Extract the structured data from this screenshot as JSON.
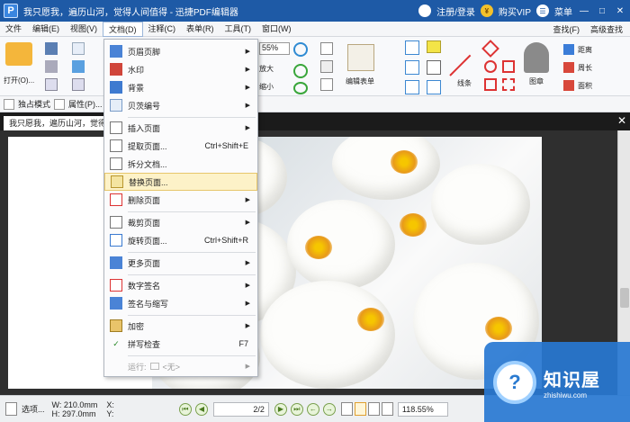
{
  "titlebar": {
    "logo_letter": "P",
    "title": "我只愿我，遍历山河，觉得人间值得 - 迅捷PDF编辑器",
    "login": "注册/登录",
    "vip_icon": "¥",
    "vip": "购买VIP",
    "menu_icon": "☰",
    "menu": "菜单",
    "minimize": "—",
    "maximize": "□",
    "close": "✕"
  },
  "menubar": {
    "items": [
      "文件",
      "编辑(E)",
      "视图(V)",
      "文档(D)",
      "注释(C)",
      "表单(R)",
      "工具(T)",
      "窗口(W)"
    ],
    "find": "查找(F)",
    "advanced_find": "高级查找"
  },
  "ribbon": {
    "open": "打开(O)...",
    "zoom_value": "55%",
    "zoom_in": "放大",
    "zoom_out": "缩小",
    "edit_form": "编辑表单",
    "line": "线条",
    "stamp": "图章",
    "distance": "距离",
    "perimeter": "周长",
    "area": "面积"
  },
  "quickbar": {
    "single_mode": "独占模式",
    "properties": "属性(P)..."
  },
  "tab": {
    "label": "我只愿我，遍历山河，觉得人",
    "close": "✕"
  },
  "dropdown": {
    "items": [
      {
        "label": "页眉页脚",
        "shortcut": "",
        "submenu": true,
        "icon": "header-footer-icon"
      },
      {
        "label": "水印",
        "shortcut": "",
        "submenu": true,
        "icon": "watermark-icon"
      },
      {
        "label": "背景",
        "shortcut": "",
        "submenu": true,
        "icon": "background-icon"
      },
      {
        "label": "贝茨编号",
        "shortcut": "",
        "submenu": true,
        "icon": "bates-icon"
      },
      {
        "label": "插入页面",
        "shortcut": "",
        "submenu": true,
        "icon": "insert-page-icon"
      },
      {
        "label": "提取页面...",
        "shortcut": "Ctrl+Shift+E",
        "submenu": false,
        "icon": "extract-page-icon"
      },
      {
        "label": "拆分文档...",
        "shortcut": "",
        "submenu": false,
        "icon": "split-doc-icon"
      },
      {
        "label": "替换页面...",
        "shortcut": "",
        "submenu": false,
        "icon": "replace-page-icon"
      },
      {
        "label": "删除页面",
        "shortcut": "",
        "submenu": true,
        "icon": "delete-page-icon"
      },
      {
        "label": "裁剪页面",
        "shortcut": "",
        "submenu": true,
        "icon": "crop-page-icon"
      },
      {
        "label": "旋转页面...",
        "shortcut": "Ctrl+Shift+R",
        "submenu": false,
        "icon": "rotate-page-icon"
      },
      {
        "label": "更多页面",
        "shortcut": "",
        "submenu": true,
        "icon": "more-pages-icon"
      },
      {
        "label": "数字签名",
        "shortcut": "",
        "submenu": true,
        "icon": "digital-sign-icon"
      },
      {
        "label": "签名与缩写",
        "shortcut": "",
        "submenu": true,
        "icon": "sign-initial-icon"
      },
      {
        "label": "加密",
        "shortcut": "",
        "submenu": true,
        "icon": "encrypt-icon"
      },
      {
        "label": "拼写检查",
        "shortcut": "F7",
        "submenu": false,
        "icon": "spell-check-icon"
      }
    ],
    "footer_label": "运行:",
    "footer_value": "<无>"
  },
  "statusbar": {
    "options": "选项...",
    "width": "W: 210.0mm",
    "height": "H: 297.0mm",
    "x": "X:",
    "y": "Y:",
    "page": "2/2",
    "zoom": "118.55%"
  },
  "watermark": {
    "brand": "知识屋",
    "url": "zhishiwu.com"
  },
  "colors": {
    "titlebar": "#1e5aa6",
    "highlight": "#fdf2c8",
    "watermark": "#2878d2"
  }
}
